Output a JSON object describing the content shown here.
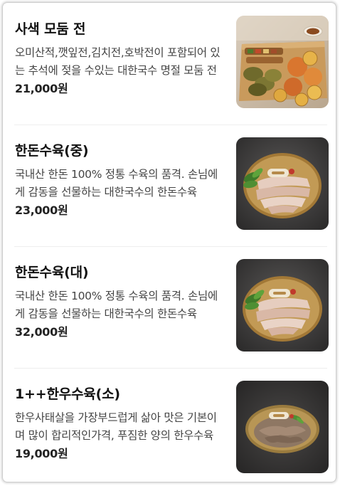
{
  "menu": {
    "items": [
      {
        "name": "사색 모둠 전",
        "description": "오미산적,깻잎전,김치전,호박전이 포함되어 있는 추석에 젖을 수있는 대한국수 명절 모둠 전",
        "price": "21,000원",
        "image": "jeon-platter-photo"
      },
      {
        "name": "한돈수육(중)",
        "description": "국내산 한돈 100% 정통 수육의 품격. 손님에게 감동을 선물하는 대한국수의 한돈수육",
        "price": "23,000원",
        "image": "pork-suyuk-photo"
      },
      {
        "name": "한돈수육(대)",
        "description": "국내산 한돈 100% 정통 수육의 품격. 손님에게 감동을 선물하는 대한국수의 한돈수육",
        "price": "32,000원",
        "image": "pork-suyuk-photo"
      },
      {
        "name": "1++한우수육(소)",
        "description": "한우사태살을 가장부드럽게 삶아 맛은 기본이며 많이 합리적인가격, 푸짐한 양의 한우수육",
        "price": "19,000원",
        "image": "beef-suyuk-photo"
      }
    ]
  }
}
